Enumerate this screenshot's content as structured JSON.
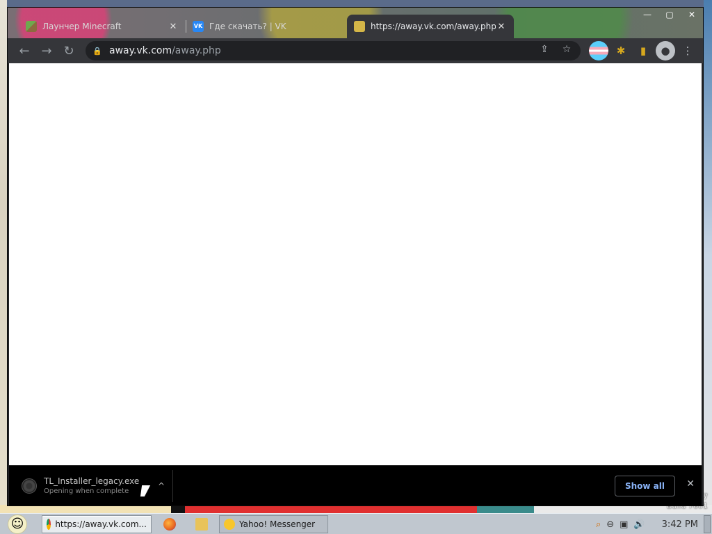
{
  "browser": {
    "tabs": [
      {
        "title": "Лаунчер Minecraft",
        "favicon": "minecraft-icon",
        "active": false
      },
      {
        "title": "Где скачать? | VK",
        "favicon": "vk-icon",
        "active": false
      },
      {
        "title": "https://away.vk.com/away.php",
        "favicon": "away-icon",
        "active": true
      }
    ],
    "tab_close_glyph": "✕",
    "window_controls": {
      "minimize": "—",
      "maximize": "▢",
      "close": "✕"
    },
    "address": {
      "host": "away.vk.com",
      "path": "/away.php"
    },
    "nav": {
      "back": "←",
      "forward": "→",
      "reload": "↻"
    },
    "lock_glyph": "🔒",
    "omni_actions": {
      "share": "⇪",
      "bookmark": "☆"
    },
    "extensions": {
      "puzzle": "✱",
      "panel": "▮",
      "avatar": "●",
      "menu": "⋮"
    }
  },
  "download_shelf": {
    "file_name": "TL_Installer_legacy.exe",
    "status": "Opening when complete",
    "chevron": "^",
    "show_all_label": "Show all",
    "close_glyph": "✕"
  },
  "desktop": {
    "build_text": "Build 7601",
    "build_digit": "7"
  },
  "taskbar": {
    "start_glyph": "☺",
    "chrome_task_label": "https://away.vk.com...",
    "yahoo_task_label": "Yahoo! Messenger",
    "clock": "3:42 PM",
    "tray": {
      "search": "⌕",
      "network": "⊖",
      "display": "▣",
      "volume": "🔊"
    }
  },
  "colors": {
    "accent_link": "#8ab4f8",
    "chrome_bar": "#35363a",
    "taskbar": "#c0c7cf"
  }
}
